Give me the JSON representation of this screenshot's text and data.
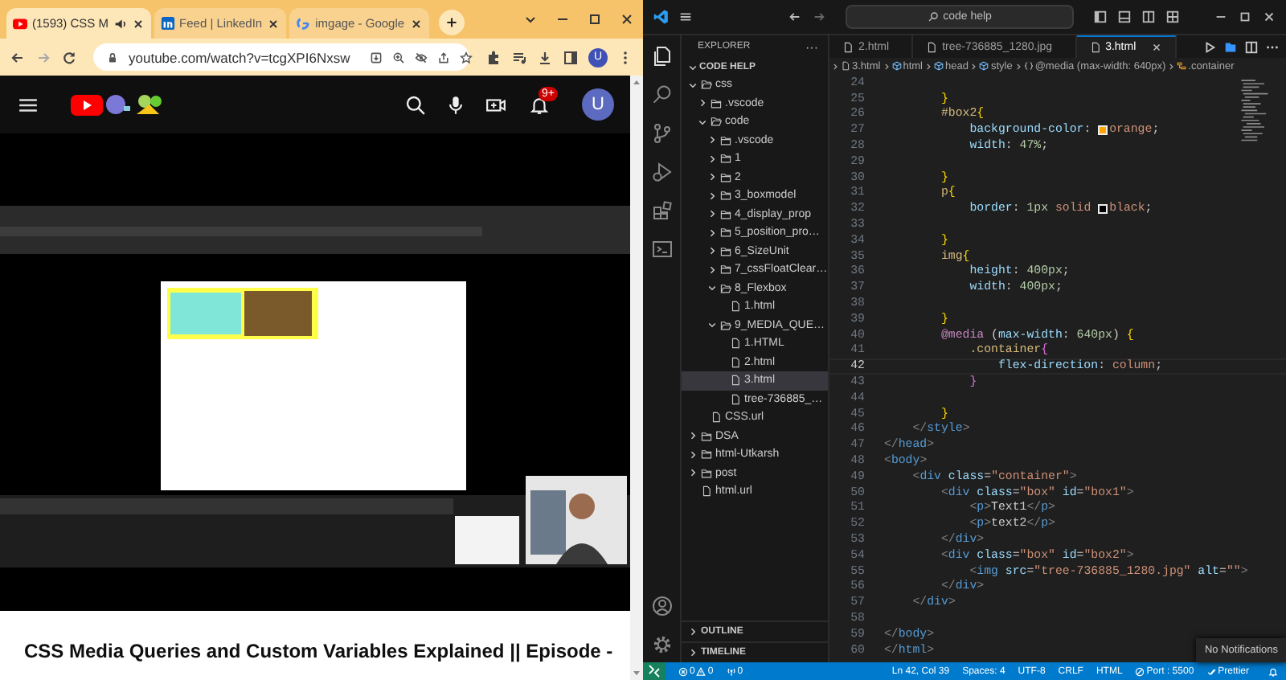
{
  "browser": {
    "tabs": [
      {
        "title": "(1593) CSS M",
        "kind": "youtube",
        "audio": true,
        "selected": true
      },
      {
        "title": "Feed | LinkedIn",
        "kind": "linkedin",
        "audio": false,
        "selected": false
      },
      {
        "title": "imgage - Google",
        "kind": "google",
        "audio": false,
        "selected": false
      }
    ],
    "address": "youtube.com/watch?v=tcgXPI6Nxsw",
    "profile": "U"
  },
  "youtube": {
    "notification_badge": "9+",
    "avatar": "U",
    "video_title": "CSS Media Queries and Custom Variables Explained || Episode -"
  },
  "vscode": {
    "search": "code help",
    "explorer": {
      "title": "EXPLORER",
      "more": "···",
      "root": {
        "name": "CODE HELP",
        "expanded": true,
        "children": [
          {
            "name": "css",
            "kind": "folder",
            "expanded": true,
            "selected": false,
            "children": [
              {
                "name": ".vscode",
                "kind": "folder",
                "expanded": false,
                "selected": false
              },
              {
                "name": "code",
                "kind": "folder",
                "expanded": true,
                "selected": false,
                "children": [
                  {
                    "name": ".vscode",
                    "kind": "folder",
                    "expanded": false,
                    "selected": false
                  },
                  {
                    "name": "1",
                    "kind": "folder",
                    "expanded": false,
                    "selected": false
                  },
                  {
                    "name": "2",
                    "kind": "folder",
                    "expanded": false,
                    "selected": false
                  },
                  {
                    "name": "3_boxmodel",
                    "kind": "folder",
                    "expanded": false,
                    "selected": false
                  },
                  {
                    "name": "4_display_prop",
                    "kind": "folder",
                    "expanded": false,
                    "selected": false
                  },
                  {
                    "name": "5_position_pro…",
                    "kind": "folder",
                    "expanded": false,
                    "selected": false
                  },
                  {
                    "name": "6_SizeUnit",
                    "kind": "folder",
                    "expanded": false,
                    "selected": false
                  },
                  {
                    "name": "7_cssFloatClear…",
                    "kind": "folder",
                    "expanded": false,
                    "selected": false
                  },
                  {
                    "name": "8_Flexbox",
                    "kind": "folder",
                    "expanded": true,
                    "selected": false,
                    "children": [
                      {
                        "name": "1.html",
                        "kind": "file",
                        "selected": false
                      }
                    ]
                  },
                  {
                    "name": "9_MEDIA_QUE…",
                    "kind": "folder",
                    "expanded": true,
                    "selected": false,
                    "children": [
                      {
                        "name": "1.HTML",
                        "kind": "file",
                        "selected": false
                      },
                      {
                        "name": "2.html",
                        "kind": "file",
                        "selected": false
                      },
                      {
                        "name": "3.html",
                        "kind": "file",
                        "selected": true
                      },
                      {
                        "name": "tree-736885_…",
                        "kind": "file",
                        "selected": false
                      }
                    ]
                  }
                ]
              },
              {
                "name": "CSS.url",
                "kind": "file",
                "selected": false
              }
            ]
          },
          {
            "name": "DSA",
            "kind": "folder",
            "expanded": false,
            "selected": false
          },
          {
            "name": "html-Utkarsh",
            "kind": "folder",
            "expanded": false,
            "selected": false
          },
          {
            "name": "post",
            "kind": "folder",
            "expanded": false,
            "selected": false
          },
          {
            "name": "html.url",
            "kind": "file",
            "selected": false
          }
        ]
      }
    },
    "sections": [
      {
        "label": "OUTLINE",
        "expanded": false
      },
      {
        "label": "TIMELINE",
        "expanded": false
      }
    ],
    "editor_tabs": [
      {
        "name": "2.html",
        "selected": false
      },
      {
        "name": "tree-736885_1280.jpg",
        "selected": false
      },
      {
        "name": "3.html",
        "selected": true
      }
    ],
    "breadcrumb": [
      {
        "text": "3.html",
        "kind": "file"
      },
      {
        "text": "html",
        "kind": "element"
      },
      {
        "text": "head",
        "kind": "element"
      },
      {
        "text": "style",
        "kind": "element"
      },
      {
        "text": "@media (max-width: 640px)",
        "kind": "braces"
      },
      {
        "text": ".container",
        "kind": "class"
      }
    ],
    "lines": [
      {
        "n": "24",
        "current": false
      },
      {
        "n": "25",
        "current": false,
        "tokens": [
          {
            "text": "        }",
            "kind": "brace"
          }
        ]
      },
      {
        "n": "26",
        "current": false,
        "tokens": [
          {
            "text": "        #box2",
            "kind": "sel"
          },
          {
            "text": "{",
            "kind": "brace"
          }
        ]
      },
      {
        "n": "27",
        "current": false,
        "tokens": [
          {
            "text": "            background-color",
            "kind": "prop"
          },
          {
            "text": ": ",
            "kind": "punct"
          },
          {
            "kind": "swatch",
            "color": "#ffa500"
          },
          {
            "text": "orange",
            "kind": "val"
          },
          {
            "text": ";",
            "kind": "punct"
          }
        ]
      },
      {
        "n": "28",
        "current": false,
        "tokens": [
          {
            "text": "            width",
            "kind": "prop"
          },
          {
            "text": ": ",
            "kind": "punct"
          },
          {
            "text": "47%",
            "kind": "num"
          },
          {
            "text": ";",
            "kind": "punct"
          }
        ]
      },
      {
        "n": "29",
        "current": false
      },
      {
        "n": "30",
        "current": false,
        "tokens": [
          {
            "text": "        }",
            "kind": "brace"
          }
        ]
      },
      {
        "n": "31",
        "current": false,
        "tokens": [
          {
            "text": "        p",
            "kind": "sel"
          },
          {
            "text": "{",
            "kind": "brace"
          }
        ]
      },
      {
        "n": "32",
        "current": false,
        "tokens": [
          {
            "text": "            border",
            "kind": "prop"
          },
          {
            "text": ": ",
            "kind": "punct"
          },
          {
            "text": "1",
            "kind": "num"
          },
          {
            "text": "px",
            "kind": "num"
          },
          {
            "text": " solid ",
            "kind": "val"
          },
          {
            "kind": "swatch",
            "color": "#000000"
          },
          {
            "text": "black",
            "kind": "val"
          },
          {
            "text": ";",
            "kind": "punct"
          }
        ]
      },
      {
        "n": "33",
        "current": false
      },
      {
        "n": "34",
        "current": false,
        "tokens": [
          {
            "text": "        }",
            "kind": "brace"
          }
        ]
      },
      {
        "n": "35",
        "current": false,
        "tokens": [
          {
            "text": "        img",
            "kind": "sel"
          },
          {
            "text": "{",
            "kind": "brace"
          }
        ]
      },
      {
        "n": "36",
        "current": false,
        "tokens": [
          {
            "text": "            height",
            "kind": "prop"
          },
          {
            "text": ": ",
            "kind": "punct"
          },
          {
            "text": "400",
            "kind": "num"
          },
          {
            "text": "px",
            "kind": "num"
          },
          {
            "text": ";",
            "kind": "punct"
          }
        ]
      },
      {
        "n": "37",
        "current": false,
        "tokens": [
          {
            "text": "            width",
            "kind": "prop"
          },
          {
            "text": ": ",
            "kind": "punct"
          },
          {
            "text": "400",
            "kind": "num"
          },
          {
            "text": "px",
            "kind": "num"
          },
          {
            "text": ";",
            "kind": "punct"
          }
        ]
      },
      {
        "n": "38",
        "current": false
      },
      {
        "n": "39",
        "current": false,
        "tokens": [
          {
            "text": "        }",
            "kind": "brace"
          }
        ]
      },
      {
        "n": "40",
        "current": false,
        "tokens": [
          {
            "text": "        @media",
            "kind": "at"
          },
          {
            "text": " (",
            "kind": "punct"
          },
          {
            "text": "max-width",
            "kind": "prop"
          },
          {
            "text": ": ",
            "kind": "punct"
          },
          {
            "text": "640",
            "kind": "num"
          },
          {
            "text": "px",
            "kind": "num"
          },
          {
            "text": ") ",
            "kind": "punct"
          },
          {
            "text": "{",
            "kind": "brace"
          }
        ]
      },
      {
        "n": "41",
        "current": false,
        "tokens": [
          {
            "text": "            .container",
            "kind": "sel"
          },
          {
            "text": "{",
            "kind": "brace2"
          }
        ]
      },
      {
        "n": "42",
        "current": true,
        "tokens": [
          {
            "text": "                flex-direction",
            "kind": "prop"
          },
          {
            "text": ": ",
            "kind": "punct"
          },
          {
            "text": "column",
            "kind": "val"
          },
          {
            "text": ";",
            "kind": "punct"
          }
        ]
      },
      {
        "n": "43",
        "current": false,
        "tokens": [
          {
            "text": "            }",
            "kind": "brace2"
          }
        ]
      },
      {
        "n": "44",
        "current": false
      },
      {
        "n": "45",
        "current": false,
        "tokens": [
          {
            "text": "        }",
            "kind": "brace"
          }
        ]
      },
      {
        "n": "46",
        "current": false,
        "tokens": [
          {
            "text": "    </",
            "kind": "ang"
          },
          {
            "text": "style",
            "kind": "tag"
          },
          {
            "text": ">",
            "kind": "ang"
          }
        ]
      },
      {
        "n": "47",
        "current": false,
        "tokens": [
          {
            "text": "</",
            "kind": "ang"
          },
          {
            "text": "head",
            "kind": "tag"
          },
          {
            "text": ">",
            "kind": "ang"
          }
        ]
      },
      {
        "n": "48",
        "current": false,
        "tokens": [
          {
            "text": "<",
            "kind": "ang"
          },
          {
            "text": "body",
            "kind": "tag"
          },
          {
            "text": ">",
            "kind": "ang"
          }
        ]
      },
      {
        "n": "49",
        "current": false,
        "tokens": [
          {
            "text": "    <",
            "kind": "ang"
          },
          {
            "text": "div",
            "kind": "tag"
          },
          {
            "text": " class",
            "kind": "attr"
          },
          {
            "text": "=",
            "kind": "punct"
          },
          {
            "text": "\"container\"",
            "kind": "str"
          },
          {
            "text": ">",
            "kind": "ang"
          }
        ]
      },
      {
        "n": "50",
        "current": false,
        "tokens": [
          {
            "text": "        <",
            "kind": "ang"
          },
          {
            "text": "div",
            "kind": "tag"
          },
          {
            "text": " class",
            "kind": "attr"
          },
          {
            "text": "=",
            "kind": "punct"
          },
          {
            "text": "\"box\"",
            "kind": "str"
          },
          {
            "text": " id",
            "kind": "attr"
          },
          {
            "text": "=",
            "kind": "punct"
          },
          {
            "text": "\"box1\"",
            "kind": "str"
          },
          {
            "text": ">",
            "kind": "ang"
          }
        ]
      },
      {
        "n": "51",
        "current": false,
        "tokens": [
          {
            "text": "            <",
            "kind": "ang"
          },
          {
            "text": "p",
            "kind": "tag"
          },
          {
            "text": ">",
            "kind": "ang"
          },
          {
            "text": "Text1",
            "kind": "text"
          },
          {
            "text": "</",
            "kind": "ang"
          },
          {
            "text": "p",
            "kind": "tag"
          },
          {
            "text": ">",
            "kind": "ang"
          }
        ]
      },
      {
        "n": "52",
        "current": false,
        "tokens": [
          {
            "text": "            <",
            "kind": "ang"
          },
          {
            "text": "p",
            "kind": "tag"
          },
          {
            "text": ">",
            "kind": "ang"
          },
          {
            "text": "text2",
            "kind": "text"
          },
          {
            "text": "</",
            "kind": "ang"
          },
          {
            "text": "p",
            "kind": "tag"
          },
          {
            "text": ">",
            "kind": "ang"
          }
        ]
      },
      {
        "n": "53",
        "current": false,
        "tokens": [
          {
            "text": "        </",
            "kind": "ang"
          },
          {
            "text": "div",
            "kind": "tag"
          },
          {
            "text": ">",
            "kind": "ang"
          }
        ]
      },
      {
        "n": "54",
        "current": false,
        "tokens": [
          {
            "text": "        <",
            "kind": "ang"
          },
          {
            "text": "div",
            "kind": "tag"
          },
          {
            "text": " class",
            "kind": "attr"
          },
          {
            "text": "=",
            "kind": "punct"
          },
          {
            "text": "\"box\"",
            "kind": "str"
          },
          {
            "text": " id",
            "kind": "attr"
          },
          {
            "text": "=",
            "kind": "punct"
          },
          {
            "text": "\"box2\"",
            "kind": "str"
          },
          {
            "text": ">",
            "kind": "ang"
          }
        ]
      },
      {
        "n": "55",
        "current": false,
        "tokens": [
          {
            "text": "            <",
            "kind": "ang"
          },
          {
            "text": "img",
            "kind": "tag"
          },
          {
            "text": " src",
            "kind": "attr"
          },
          {
            "text": "=",
            "kind": "punct"
          },
          {
            "text": "\"tree-736885_1280.jpg\"",
            "kind": "str"
          },
          {
            "text": " alt",
            "kind": "attr"
          },
          {
            "text": "=",
            "kind": "punct"
          },
          {
            "text": "\"\"",
            "kind": "str"
          },
          {
            "text": ">",
            "kind": "ang"
          }
        ]
      },
      {
        "n": "56",
        "current": false,
        "tokens": [
          {
            "text": "        </",
            "kind": "ang"
          },
          {
            "text": "div",
            "kind": "tag"
          },
          {
            "text": ">",
            "kind": "ang"
          }
        ]
      },
      {
        "n": "57",
        "current": false,
        "tokens": [
          {
            "text": "    </",
            "kind": "ang"
          },
          {
            "text": "div",
            "kind": "tag"
          },
          {
            "text": ">",
            "kind": "ang"
          }
        ]
      },
      {
        "n": "58",
        "current": false
      },
      {
        "n": "59",
        "current": false,
        "tokens": [
          {
            "text": "</",
            "kind": "ang"
          },
          {
            "text": "body",
            "kind": "tag"
          },
          {
            "text": ">",
            "kind": "ang"
          }
        ]
      },
      {
        "n": "60",
        "current": false,
        "tokens": [
          {
            "text": "</",
            "kind": "ang"
          },
          {
            "text": "html",
            "kind": "tag"
          },
          {
            "text": ">",
            "kind": "ang"
          }
        ]
      }
    ],
    "notification": "No Notifications",
    "status": {
      "errors": "0",
      "warnings": "0",
      "ports": "0",
      "right": [
        {
          "text": "Ln 42, Col 39",
          "kind": "plain"
        },
        {
          "text": "Spaces: 4",
          "kind": "plain"
        },
        {
          "text": "UTF-8",
          "kind": "plain"
        },
        {
          "text": "CRLF",
          "kind": "plain"
        },
        {
          "text": "HTML",
          "kind": "plain"
        },
        {
          "text": "Port : 5500",
          "kind": "port"
        },
        {
          "text": "Prettier",
          "kind": "check"
        }
      ]
    }
  }
}
